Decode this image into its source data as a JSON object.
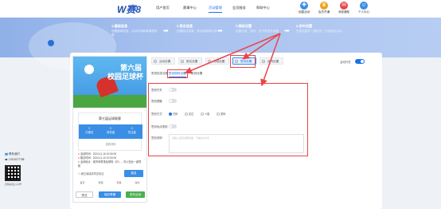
{
  "header": {
    "logo": "W",
    "logo_brand": "赛8",
    "nav": [
      "用户首页",
      "赛事中心",
      "活动管理",
      "会员服务",
      "帮助中心"
    ],
    "active_nav_index": 2,
    "icons": [
      {
        "label": "创建活动",
        "icon": "create-activity-icon",
        "color": "#3a8ee6"
      },
      {
        "label": "会员开通",
        "icon": "member-icon",
        "color": "#f0a020"
      },
      {
        "label": "消息通知",
        "icon": "bell-icon",
        "color": "#e8464a"
      },
      {
        "label": "个人中心",
        "icon": "user-icon",
        "color": "#3a8ee6"
      }
    ]
  },
  "hero": {
    "steps": [
      {
        "title": "1.基础信息",
        "desc": "设置赛事信息、活动时间和赛事规则等"
      },
      {
        "title": "2.报名信息",
        "desc": "设置报名表单、报名费用等内容"
      },
      {
        "title": "3.高级设置",
        "desc": "设置分组、签到、证书等更多设置"
      },
      {
        "title": "4.发布设置",
        "desc": "完成设置并一键发布、开启报名活动"
      }
    ]
  },
  "preview": {
    "poster_line1": "第六届",
    "poster_line2": "校园足球杯",
    "card_title": "第七届足球联赛",
    "stats": [
      {
        "value": "0",
        "label": "已报名"
      },
      {
        "value": "0",
        "label": "浏览量"
      },
      {
        "value": "0",
        "label": "关注量"
      }
    ],
    "more": "查看详情",
    "info": [
      "活动时间：2024-11-16 10:00:00",
      "报名时间：2024-11-10 10:00:00",
      "活动地点：某市体育场足球场（中），可以在此一键导航"
    ],
    "agree": "我已阅读并同意协议",
    "register_button": "报名",
    "tabbar": [
      "首页",
      "赛程",
      "赛事",
      "我的"
    ],
    "buttons": [
      "预览",
      "保存草稿",
      "发布活动"
    ]
  },
  "tabs": {
    "items": [
      "活动设置",
      "报名设置",
      "分组设置",
      "签到设置",
      "证书设置"
    ],
    "active_index": 3,
    "right_label": "活动开关",
    "right_toggle_on": true
  },
  "subtabs": {
    "items": [
      "签到信息设置",
      "签到规则设置",
      "签到设置"
    ],
    "active_index": 1
  },
  "form": {
    "rows": [
      {
        "label": "签到开关"
      },
      {
        "label": "签到提醒"
      },
      {
        "label": "签到方式"
      },
      {
        "label": "签到地点限制"
      },
      {
        "label": "签到说明"
      }
    ],
    "radio_options": [
      "扫码",
      "定位",
      "人脸",
      "密码"
    ],
    "textarea_placeholder": "请输入签到说明内容，不超过200字"
  },
  "sidebar": {
    "contact": "联系我们",
    "phone": "17615277788",
    "qr_label": "扫码关注公众号"
  },
  "colors": {
    "accent": "#1a73e8",
    "highlight": "#e8464a",
    "hero": "#a9c2ef"
  }
}
